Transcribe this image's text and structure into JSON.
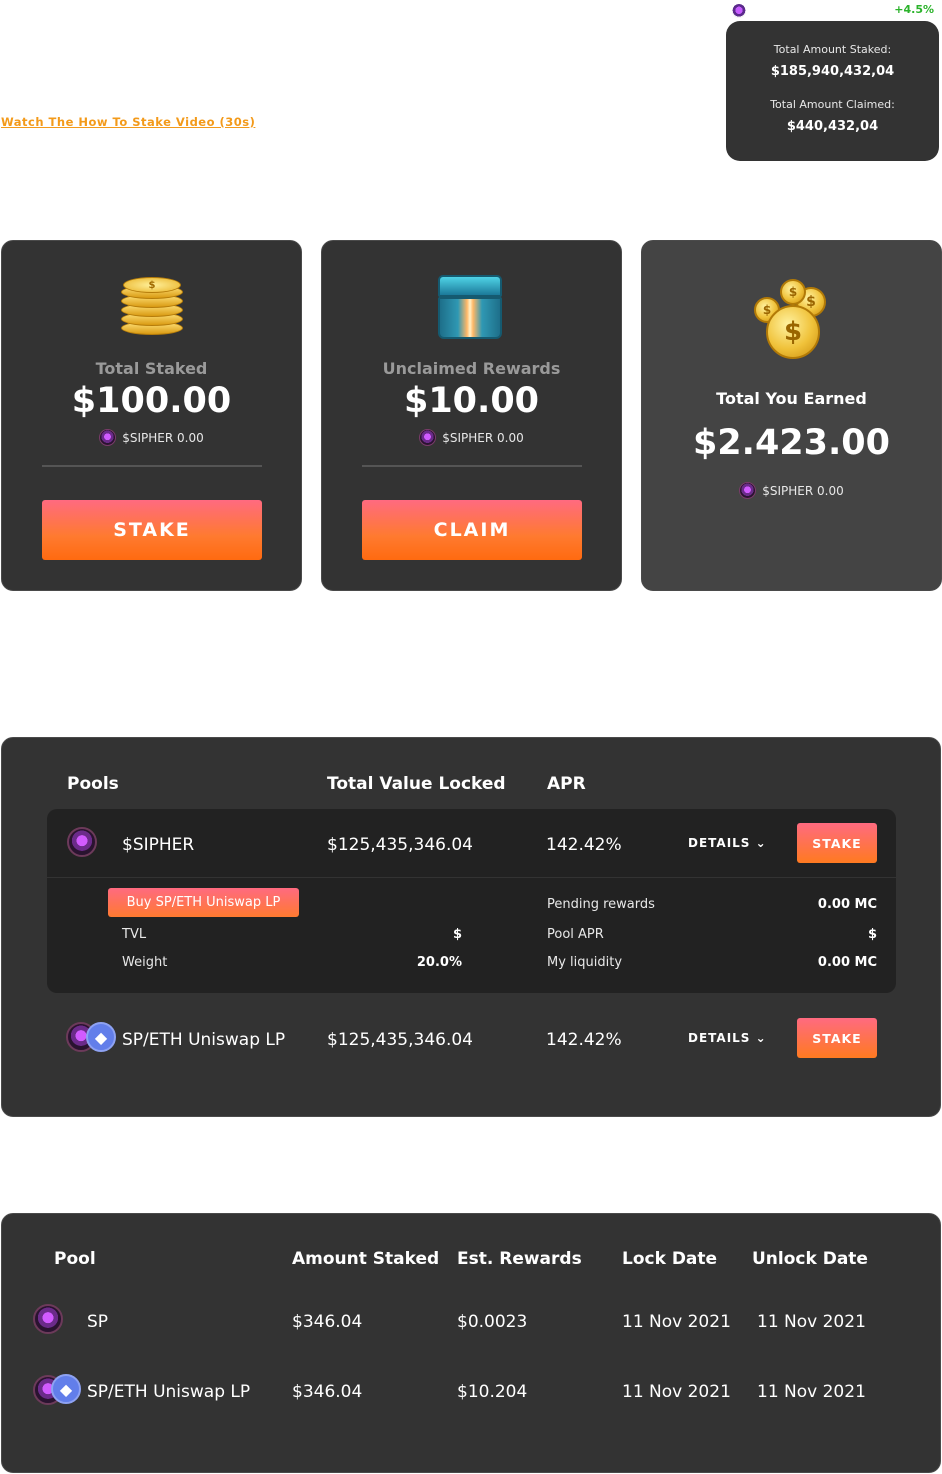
{
  "header": {
    "change_pct": "+4.5%",
    "total_staked_label": "Total Amount Staked:",
    "total_staked_value": "$185,940,432,04",
    "total_claimed_label": "Total Amount Claimed:",
    "total_claimed_value": "$440,432,04",
    "video_link": "Watch The How To Stake Video (30s)"
  },
  "cards": {
    "staked": {
      "title": "Total Staked",
      "amount": "$100.00",
      "sub": "$SIPHER 0.00",
      "button": "STAKE"
    },
    "unclaimed": {
      "title": "Unclaimed Rewards",
      "amount": "$10.00",
      "sub": "$SIPHER 0.00",
      "button": "CLAIM"
    },
    "earned": {
      "title": "Total You Earned",
      "amount": "$2.423.00",
      "sub": "$SIPHER 0.00"
    }
  },
  "pools": {
    "headers": {
      "pools": "Pools",
      "tvl": "Total Value Locked",
      "apr": "APR"
    },
    "rows": [
      {
        "name": "$SIPHER",
        "tvl": "$125,435,346.04",
        "apr": "142.42%",
        "details": "DETAILS ⌄",
        "stake": "STAKE"
      },
      {
        "name": "SP/ETH Uniswap LP",
        "tvl": "$125,435,346.04",
        "apr": "142.42%",
        "details": "DETAILS ⌄",
        "stake": "STAKE"
      }
    ],
    "expanded": {
      "buy_button": "Buy SP/ETH Uniswap LP",
      "tvl_label": "TVL",
      "tvl_value": "$",
      "weight_label": "Weight",
      "weight_value": "20.0%",
      "pending_label": "Pending rewards",
      "pending_value": "0.00 MC",
      "apr_label": "Pool APR",
      "apr_value": "$",
      "liquidity_label": "My liquidity",
      "liquidity_value": "0.00 MC"
    }
  },
  "staked_table": {
    "headers": {
      "pool": "Pool",
      "amount": "Amount Staked",
      "rewards": "Est. Rewards",
      "lock": "Lock Date",
      "unlock": "Unlock Date"
    },
    "rows": [
      {
        "pool": "SP",
        "amount": "$346.04",
        "rewards": "$0.0023",
        "lock": "11 Nov 2021",
        "unlock": "11 Nov 2021"
      },
      {
        "pool": "SP/ETH Uniswap LP",
        "amount": "$346.04",
        "rewards": "$10.204",
        "lock": "11 Nov 2021",
        "unlock": "11 Nov 2021"
      }
    ]
  },
  "colors": {
    "accent_orange": "#ff7a20",
    "link_orange": "#f39a1a",
    "positive_green": "#2bb32b",
    "panel": "#333333"
  },
  "icons": {
    "sipher": "sipher-token-icon",
    "eth": "ethereum-icon",
    "coins": "gold-coins-icon",
    "chest": "reward-chest-icon"
  }
}
